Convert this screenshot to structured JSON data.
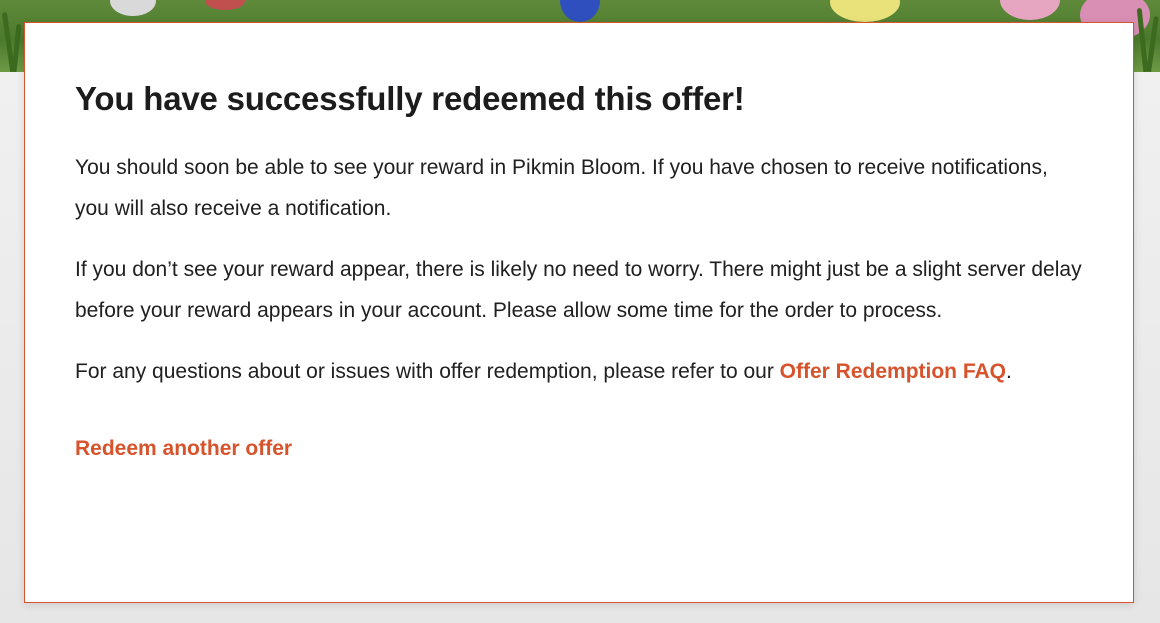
{
  "colors": {
    "accent": "#d6532c",
    "card_border": "#d9542e",
    "text": "#202020",
    "heading": "#1c1c1c"
  },
  "confirmation": {
    "title": "You have successfully redeemed this offer!",
    "paragraph1": "You should soon be able to see your reward in Pikmin Bloom. If you have chosen to receive notifications, you will also receive a notification.",
    "paragraph2": "If you don’t see your reward appear, there is likely no need to worry. There might just be a slight server delay before your reward appears in your account. Please allow some time for the order to process.",
    "paragraph3_prefix": "For any questions about or issues with offer redemption, please refer to our ",
    "faq_link_label": "Offer Redemption FAQ",
    "paragraph3_suffix": ".",
    "redeem_another_label": "Redeem another offer"
  }
}
